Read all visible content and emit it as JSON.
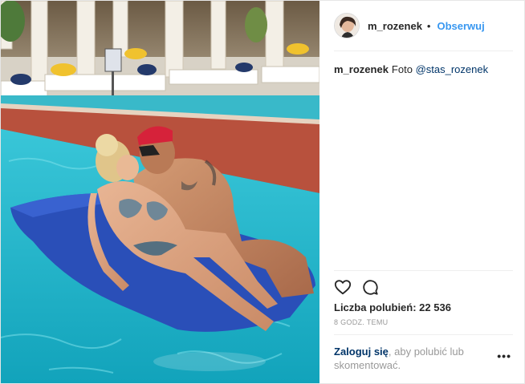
{
  "header": {
    "username": "m_rozenek",
    "separator": "•",
    "follow_label": "Obserwuj"
  },
  "caption": {
    "username": "m_rozenek",
    "text": "Foto",
    "mention": "@stas_rozenek"
  },
  "actions": {
    "like_icon": "heart-icon",
    "comment_icon": "comment-icon"
  },
  "likes": {
    "text": "Liczba polubień: 22 536"
  },
  "timestamp": "8 GODZ. TEMU",
  "login_prompt": {
    "link": "Zaloguj się",
    "text": ", aby polubić lub skomentować."
  },
  "more_options": "•••",
  "colors": {
    "link_blue": "#3897f0",
    "dark_link": "#003569",
    "pool_water": "#1fb3c8",
    "float_blue": "#2a4fb8"
  }
}
